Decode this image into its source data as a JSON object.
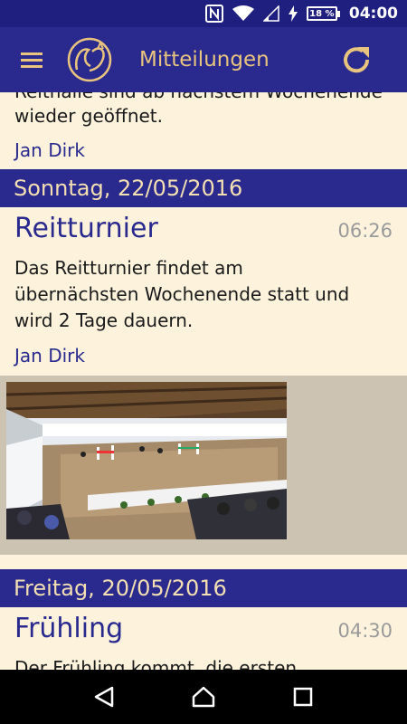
{
  "status_bar": {
    "time": "04:00",
    "battery_text": "18 %",
    "icons": [
      "nfc-icon",
      "wifi-icon",
      "signal-icon",
      "charging-icon",
      "battery-icon"
    ]
  },
  "app_bar": {
    "title": "Mitteilungen",
    "menu_icon": "hamburger-menu-icon",
    "logo_icon": "horse-logo-icon",
    "refresh_icon": "refresh-icon",
    "accent_color": "#e8c47e",
    "bar_color": "#2a2a8e"
  },
  "feed": {
    "partial_post": {
      "clipped_line": "Reithalle sind ab nächstem Wochenende",
      "text_line": "wieder geöffnet.",
      "author": "Jan Dirk"
    },
    "sections": [
      {
        "date": "Sonntag, 22/05/2016",
        "post": {
          "title": "Reitturnier",
          "time": "06:26",
          "text": "Das Reitturnier findet am übernächsten Wochenende statt und wird 2 Tage dauern.",
          "author": "Jan Dirk",
          "has_photo": true
        }
      },
      {
        "date": "Freitag, 20/05/2016",
        "post": {
          "title": "Frühling",
          "time": "04:30",
          "text": "Der Frühling kommt, die ersten Weiden"
        }
      }
    ]
  },
  "nav_bar": {
    "back_icon": "back-triangle-icon",
    "home_icon": "home-icon",
    "recents_icon": "recents-square-icon"
  }
}
